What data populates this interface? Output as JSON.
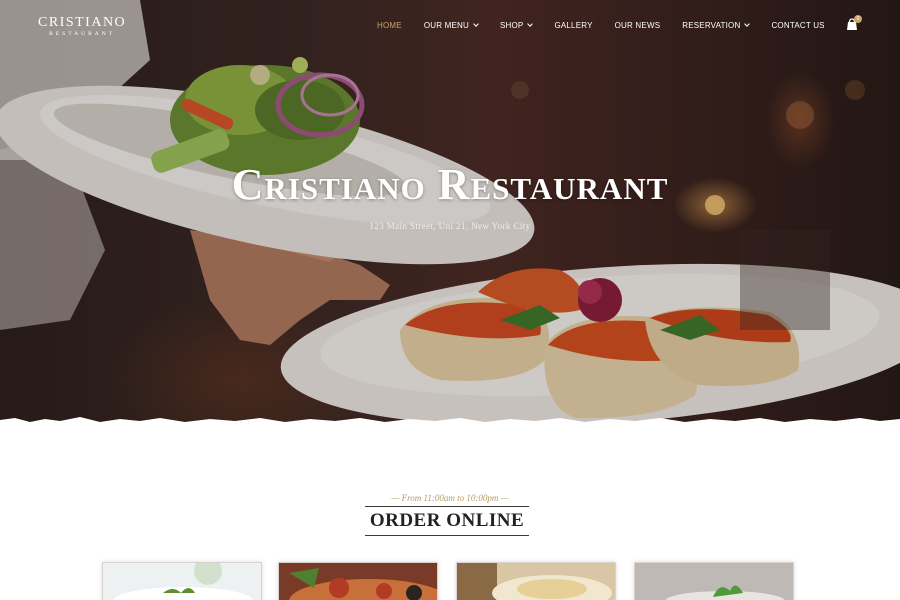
{
  "brand": {
    "logo_main": "CRISTIANO",
    "logo_sub": "RESTAURANT"
  },
  "nav": {
    "items": [
      {
        "label": "HOME",
        "has_dropdown": false,
        "active": true
      },
      {
        "label": "OUR MENU",
        "has_dropdown": true,
        "active": false
      },
      {
        "label": "SHOP",
        "has_dropdown": true,
        "active": false
      },
      {
        "label": "GALLERY",
        "has_dropdown": false,
        "active": false
      },
      {
        "label": "OUR NEWS",
        "has_dropdown": false,
        "active": false
      },
      {
        "label": "RESERVATION",
        "has_dropdown": true,
        "active": false
      },
      {
        "label": "CONTACT US",
        "has_dropdown": false,
        "active": false
      }
    ],
    "cart_count": "0",
    "cart_icon": "shopping-bag-icon"
  },
  "hero": {
    "title": "Cristiano Restaurant",
    "address": "123 Main Street, Uni 21, New York City"
  },
  "order_section": {
    "hours": "— From 11:00am to 10:00pm —",
    "title": "ORDER ONLINE",
    "cards": [
      {
        "image": "salad-dish"
      },
      {
        "image": "pizza-dish"
      },
      {
        "image": "pasta-dish"
      },
      {
        "image": "garnished-dish"
      }
    ]
  },
  "colors": {
    "accent_gold": "#c9a568",
    "hero_dark": "#2a1f1c",
    "text_dark": "#222222"
  }
}
